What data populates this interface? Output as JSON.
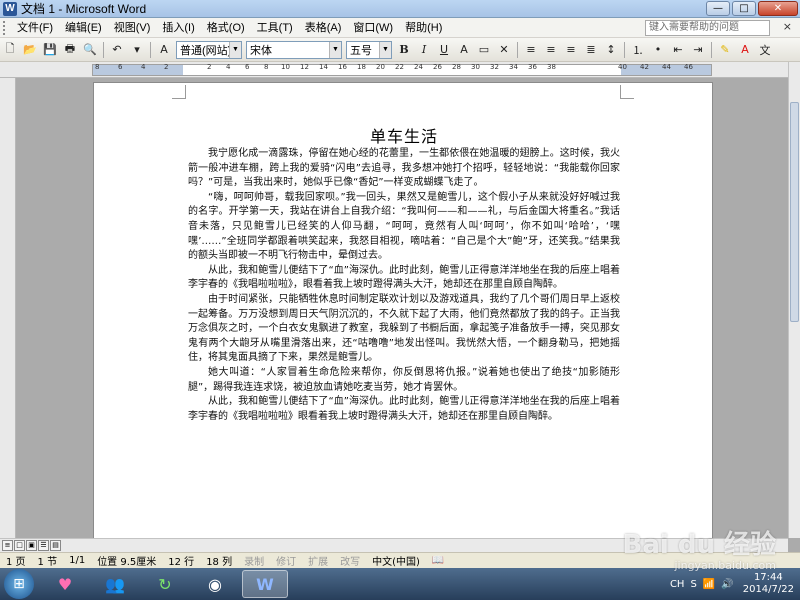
{
  "window": {
    "title": "文档 1 - Microsoft Word",
    "minimize": "—",
    "maximize": "□",
    "close": "✕"
  },
  "menu": {
    "items": [
      "文件(F)",
      "编辑(E)",
      "视图(V)",
      "插入(I)",
      "格式(O)",
      "工具(T)",
      "表格(A)",
      "窗口(W)",
      "帮助(H)"
    ],
    "help_placeholder": "键入需要帮助的问题",
    "close": "×"
  },
  "toolbar": {
    "style_value": "普通(网站)",
    "font_value": "宋体",
    "size_value": "五号",
    "bold": "B",
    "italic": "I",
    "underline": "U",
    "font_size_a": "A"
  },
  "ruler": {
    "labels": [
      "8",
      "6",
      "4",
      "2",
      "2",
      "4",
      "6",
      "8",
      "10",
      "12",
      "14",
      "16",
      "18",
      "20",
      "22",
      "24",
      "26",
      "28",
      "30",
      "32",
      "34",
      "36",
      "38",
      "40",
      "42",
      "44",
      "46"
    ]
  },
  "document": {
    "title": "单车生活",
    "paragraphs": [
      "我宁愿化成一滴露珠，停留在她心经的花蕾里，一生都依偎在她温暖的翅膀上。这时候，我火箭一般冲进车棚，跨上我的爱骑“闪电”去追寻，我多想冲她打个招呼，轻轻地说：“我能载你回家吗？”可是，当我出来时，她似乎已像“香妃”一样变成蝴蝶飞走了。",
      "“嗨，呵呵帅哥，载我回家呗。”我一回头，果然又是鲍雪儿，这个假小子从来就没好好喊过我的名字。开学第一天，我站在讲台上自我介绍：“我叫何——和——礼，与后金国大将重名。”我话音未落，只见鲍雪儿已经笑的人仰马翻，“呵呵，竟然有人叫‘呵呵’，你不如叫‘哈哈’，‘嘿嘿’……”全班同学都跟着哄笑起来，我怒目相视，嘀咕着：“自己是个大”鲍”牙，还笑我。”结果我的额头当即被一不明飞行物击中，晕倒过去。",
      "从此，我和鲍雪儿便结下了“血”海深仇。此时此刻，鲍雪儿正得意洋洋地坐在我的后座上唱着李宇春的《我唱啦啦啦》，眼看着我上坡时蹬得满头大汗，她却还在那里自顾自陶醉。",
      "由于时间紧张，只能牺牲休息时间制定联欢计划以及游戏道具，我约了几个哥们周日早上返校一起筹备。万万没想到周日天气阴沉沉的，不久就下起了大雨，他们竟然都放了我的鸽子。正当我万念俱灰之时，一个白衣女鬼飘进了教室，我躲到了书橱后面，拿起笺子准备放手一搏，突见那女鬼有两个大龅牙从嘴里滑落出来，还“咕噜噜”地发出怪叫。我恍然大悟，一个翻身勒马，把她摇住，将其鬼面具摘了下来，果然是鲍雪儿。",
      "她大叫道：“人家冒着生命危险来帮你，你反倒恩将仇报。”说着她也使出了绝技“加影随形腿”，踢得我连连求饶，被迫放血请她吃麦当劳，她才肯罢休。",
      "从此，我和鲍雪儿便结下了“血”海深仇。此时此刻，鲍雪儿正得意洋洋地坐在我的后座上唱着李宇春的《我唱啦啦啦》眼看着我上坡时蹬得满头大汗，她却还在那里自顾自陶醉。"
    ]
  },
  "status": {
    "page": "1 页",
    "section": "1 节",
    "pages": "1/1",
    "position": "位置 9.5厘米",
    "line": "12 行",
    "column": "18 列",
    "rec": "录制",
    "trk": "修订",
    "ext": "扩展",
    "ovr": "改写",
    "language": "中文(中国)"
  },
  "taskbar": {
    "items": [
      "ie-icon",
      "users-icon",
      "refresh-icon",
      "media-icon",
      "word-icon"
    ],
    "lang": "CH",
    "time": "17:44",
    "date": "2014/7/22"
  },
  "watermark": {
    "main": "Bai du 经验",
    "sub": "jingyan.baidu.com"
  }
}
